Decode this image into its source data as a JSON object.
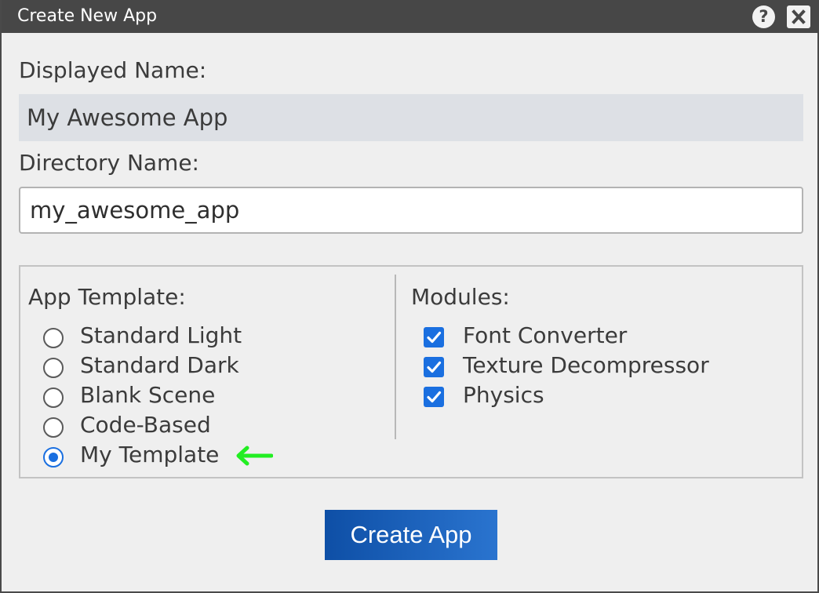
{
  "window": {
    "title": "Create New App",
    "help_label": "?"
  },
  "form": {
    "displayed_name_label": "Displayed Name:",
    "displayed_name_value": "My Awesome App",
    "directory_name_label": "Directory Name:",
    "directory_name_value": "my_awesome_app"
  },
  "templates": {
    "label": "App Template:",
    "options": [
      {
        "label": "Standard Light",
        "selected": false
      },
      {
        "label": "Standard Dark",
        "selected": false
      },
      {
        "label": "Blank Scene",
        "selected": false
      },
      {
        "label": "Code-Based",
        "selected": false
      },
      {
        "label": "My Template",
        "selected": true
      }
    ],
    "indicator": "arrow-left-icon",
    "indicator_color": "#22ee22"
  },
  "modules": {
    "label": "Modules:",
    "items": [
      {
        "label": "Font Converter",
        "checked": true
      },
      {
        "label": "Texture Decompressor",
        "checked": true
      },
      {
        "label": "Physics",
        "checked": true
      }
    ]
  },
  "actions": {
    "create_label": "Create App"
  },
  "colors": {
    "titlebar": "#474747",
    "accent": "#1a6fe0",
    "button_start": "#0e4fa6",
    "button_end": "#2a74cf"
  }
}
